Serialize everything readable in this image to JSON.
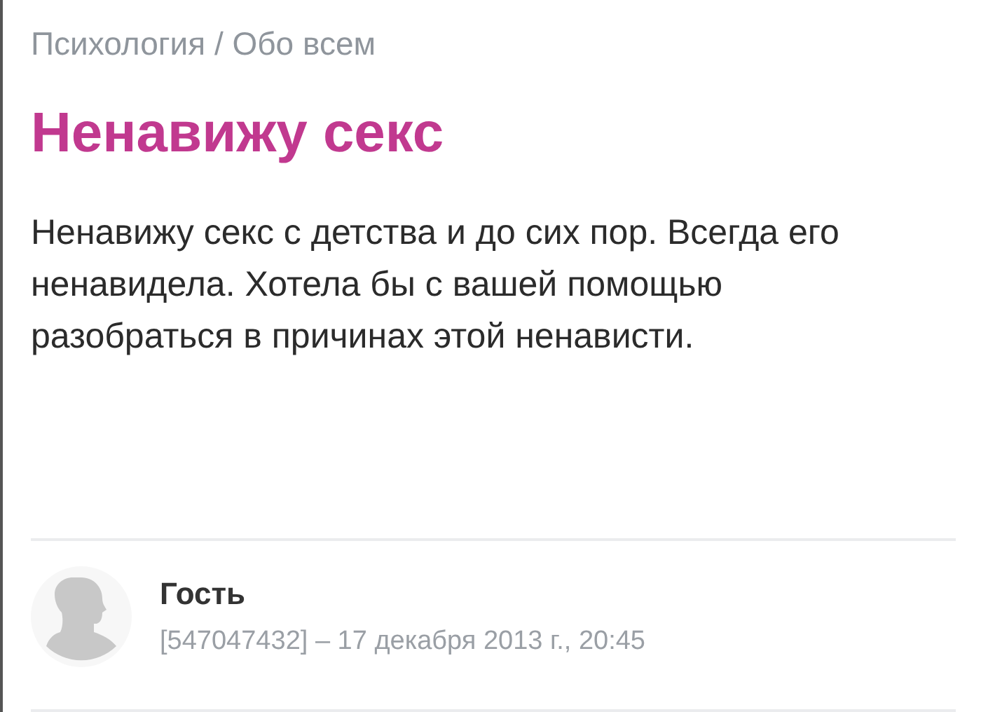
{
  "breadcrumb": "Психология / Обо всем",
  "title": "Ненавижу секс",
  "body": "Ненавижу секс с детства и до сих пор. Всегда его ненавидела. Хотела бы с вашей помощью разобраться в причинах этой ненависти.",
  "author": {
    "name": "Гость",
    "meta": "[547047432] – 17 декабря 2013 г., 20:45"
  }
}
